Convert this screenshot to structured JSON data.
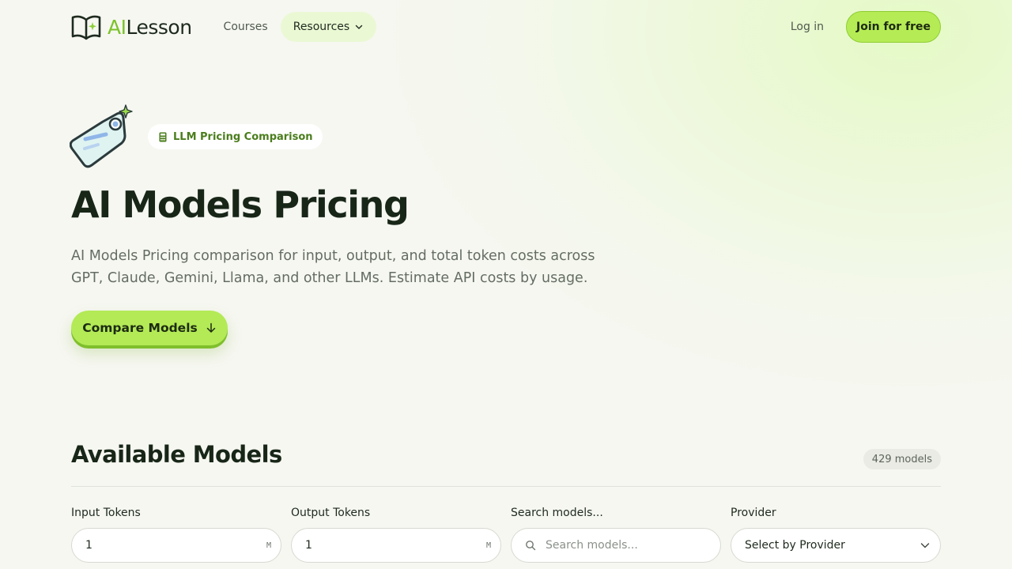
{
  "header": {
    "logo": {
      "ai": "AI",
      "lesson": "Lesson"
    },
    "nav": {
      "courses": "Courses",
      "resources": "Resources"
    },
    "login": "Log in",
    "join": "Join for free"
  },
  "hero": {
    "badge": "LLM Pricing Comparison",
    "title": "AI Models Pricing",
    "description": "AI Models Pricing comparison for input, output, and total token costs across GPT, Claude, Gemini, Llama, and other LLMs. Estimate API costs by usage.",
    "cta": "Compare Models"
  },
  "models": {
    "title": "Available Models",
    "count": "429 models",
    "filters": {
      "input": {
        "label": "Input Tokens",
        "value": "1",
        "unit": "M"
      },
      "output": {
        "label": "Output Tokens",
        "value": "1",
        "unit": "M"
      },
      "search": {
        "label": "Search models...",
        "placeholder": "Search models..."
      },
      "provider": {
        "label": "Provider",
        "value": "Select by Provider"
      }
    }
  },
  "colors": {
    "accent": "#b5ec55",
    "brand_green": "#7cc22a",
    "text_dark": "#182618"
  },
  "icons": [
    "open-book-sparkle-icon",
    "chevron-down-icon",
    "price-tag-icon",
    "calculator-icon",
    "arrow-down-icon",
    "search-icon"
  ]
}
